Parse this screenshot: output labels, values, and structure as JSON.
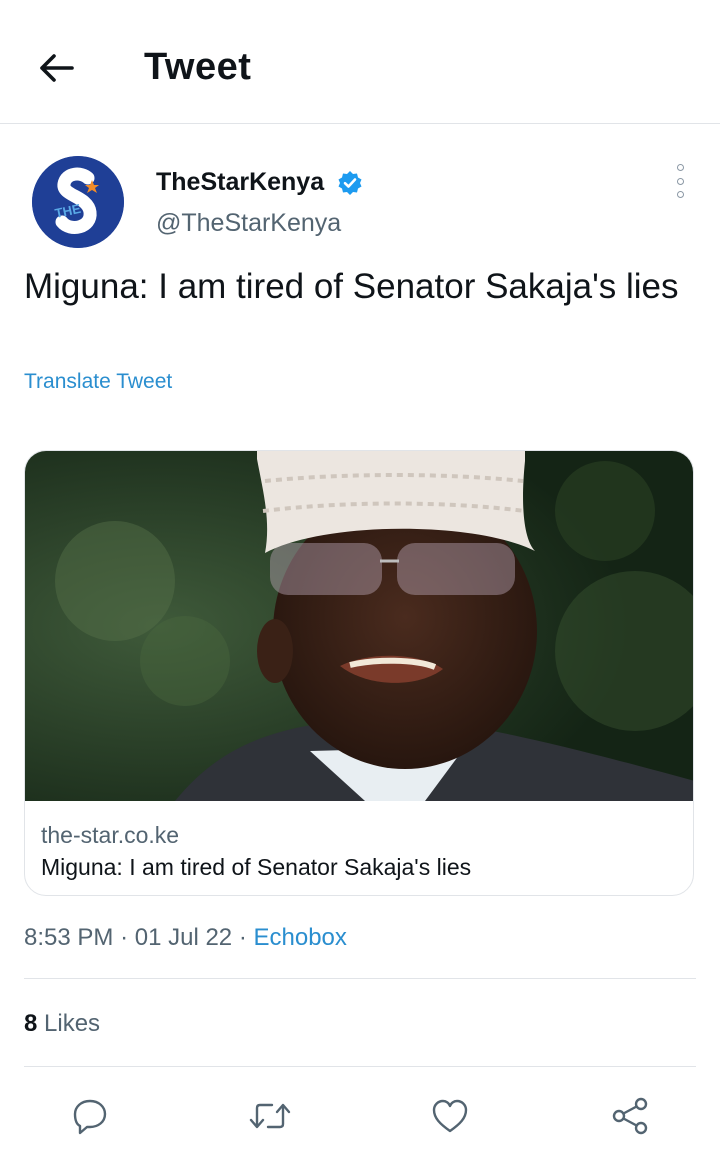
{
  "header": {
    "title": "Tweet",
    "back_icon": "arrow-left-icon"
  },
  "author": {
    "display_name": "TheStarKenya",
    "handle": "@TheStarKenya",
    "verified": true,
    "avatar_letters": "THE",
    "avatar_colors": {
      "bg": "#1f3f96",
      "star": "#f28c28"
    }
  },
  "tweet": {
    "text": "Miguna: I am tired of Senator Sakaja's lies",
    "translate_label": "Translate Tweet"
  },
  "card": {
    "domain": "the-star.co.ke",
    "title": "Miguna: I am tired of Senator Sakaja's lies"
  },
  "meta": {
    "time": "8:53 PM",
    "sep1": "·",
    "date": "01 Jul 22",
    "sep2": "·",
    "source": "Echobox"
  },
  "stats": {
    "likes_count": "8",
    "likes_label": "Likes"
  },
  "actions": [
    {
      "name": "reply",
      "icon": "reply-icon"
    },
    {
      "name": "retweet",
      "icon": "retweet-icon"
    },
    {
      "name": "like",
      "icon": "heart-icon"
    },
    {
      "name": "share",
      "icon": "share-icon"
    }
  ],
  "colors": {
    "accent": "#2a8ecf",
    "text": "#0f1419",
    "muted": "#536471",
    "divider": "#e1e4e8"
  }
}
